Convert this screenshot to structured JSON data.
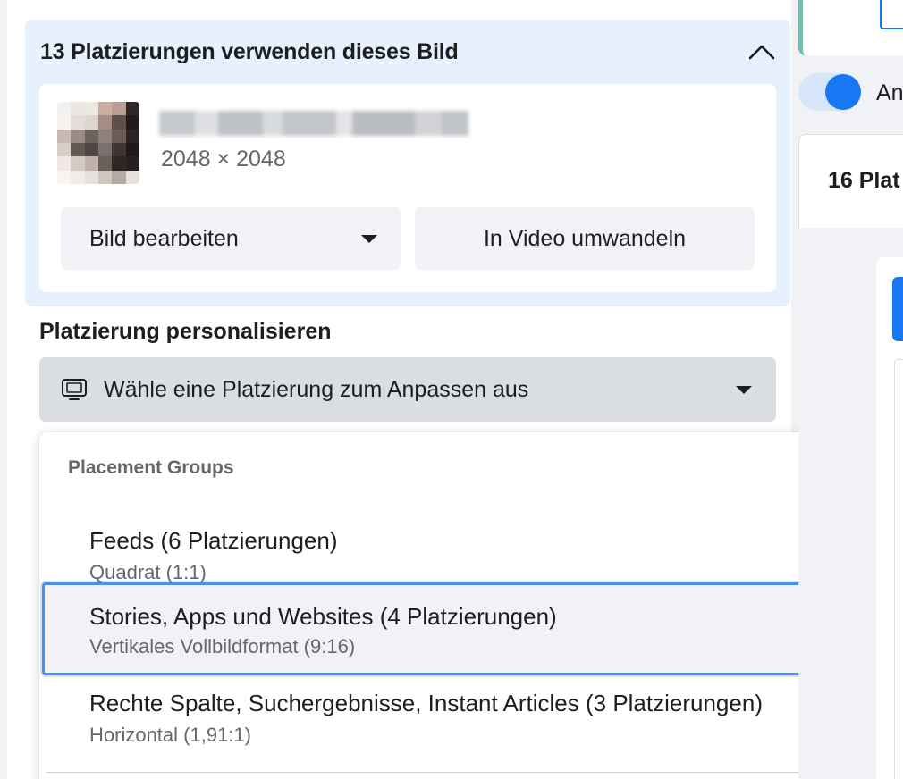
{
  "usage_panel": {
    "title": "13 Platzierungen verwenden dieses Bild",
    "image": {
      "dimensions": "2048 × 2048"
    },
    "buttons": {
      "edit_label": "Bild bearbeiten",
      "video_label": "In Video umwandeln"
    }
  },
  "personalize": {
    "title": "Platzierung personalisieren",
    "select_label": "Wähle eine Platzierung zum Anpassen aus"
  },
  "dropdown": {
    "group_header": "Placement Groups",
    "options": [
      {
        "title": "Feeds (6 Platzierungen)",
        "subtitle": "Quadrat (1:1)"
      },
      {
        "title": "Stories, Apps und Websites (4 Platzierungen)",
        "subtitle": "Vertikales Vollbildformat (9:16)"
      },
      {
        "title": "Rechte Spalte, Suchergebnisse, Instant Articles (3 Platzierungen)",
        "subtitle": "Horizontal (1,91:1)"
      }
    ],
    "highlighted_index": 1
  },
  "right_column": {
    "toggle_label": "An",
    "card_title": "16 Plat"
  },
  "colors": {
    "accent_blue": "#1877f2",
    "panel_blue": "#e7f0fd",
    "focus_ring": "#4a90f2",
    "secondary_text": "#65676b",
    "teal_border": "#63c7b2"
  },
  "icons": {
    "collapse": "chevron-up-icon",
    "dropdown": "caret-down-icon",
    "placement": "monitor-icon",
    "edit": "edit-icon"
  }
}
